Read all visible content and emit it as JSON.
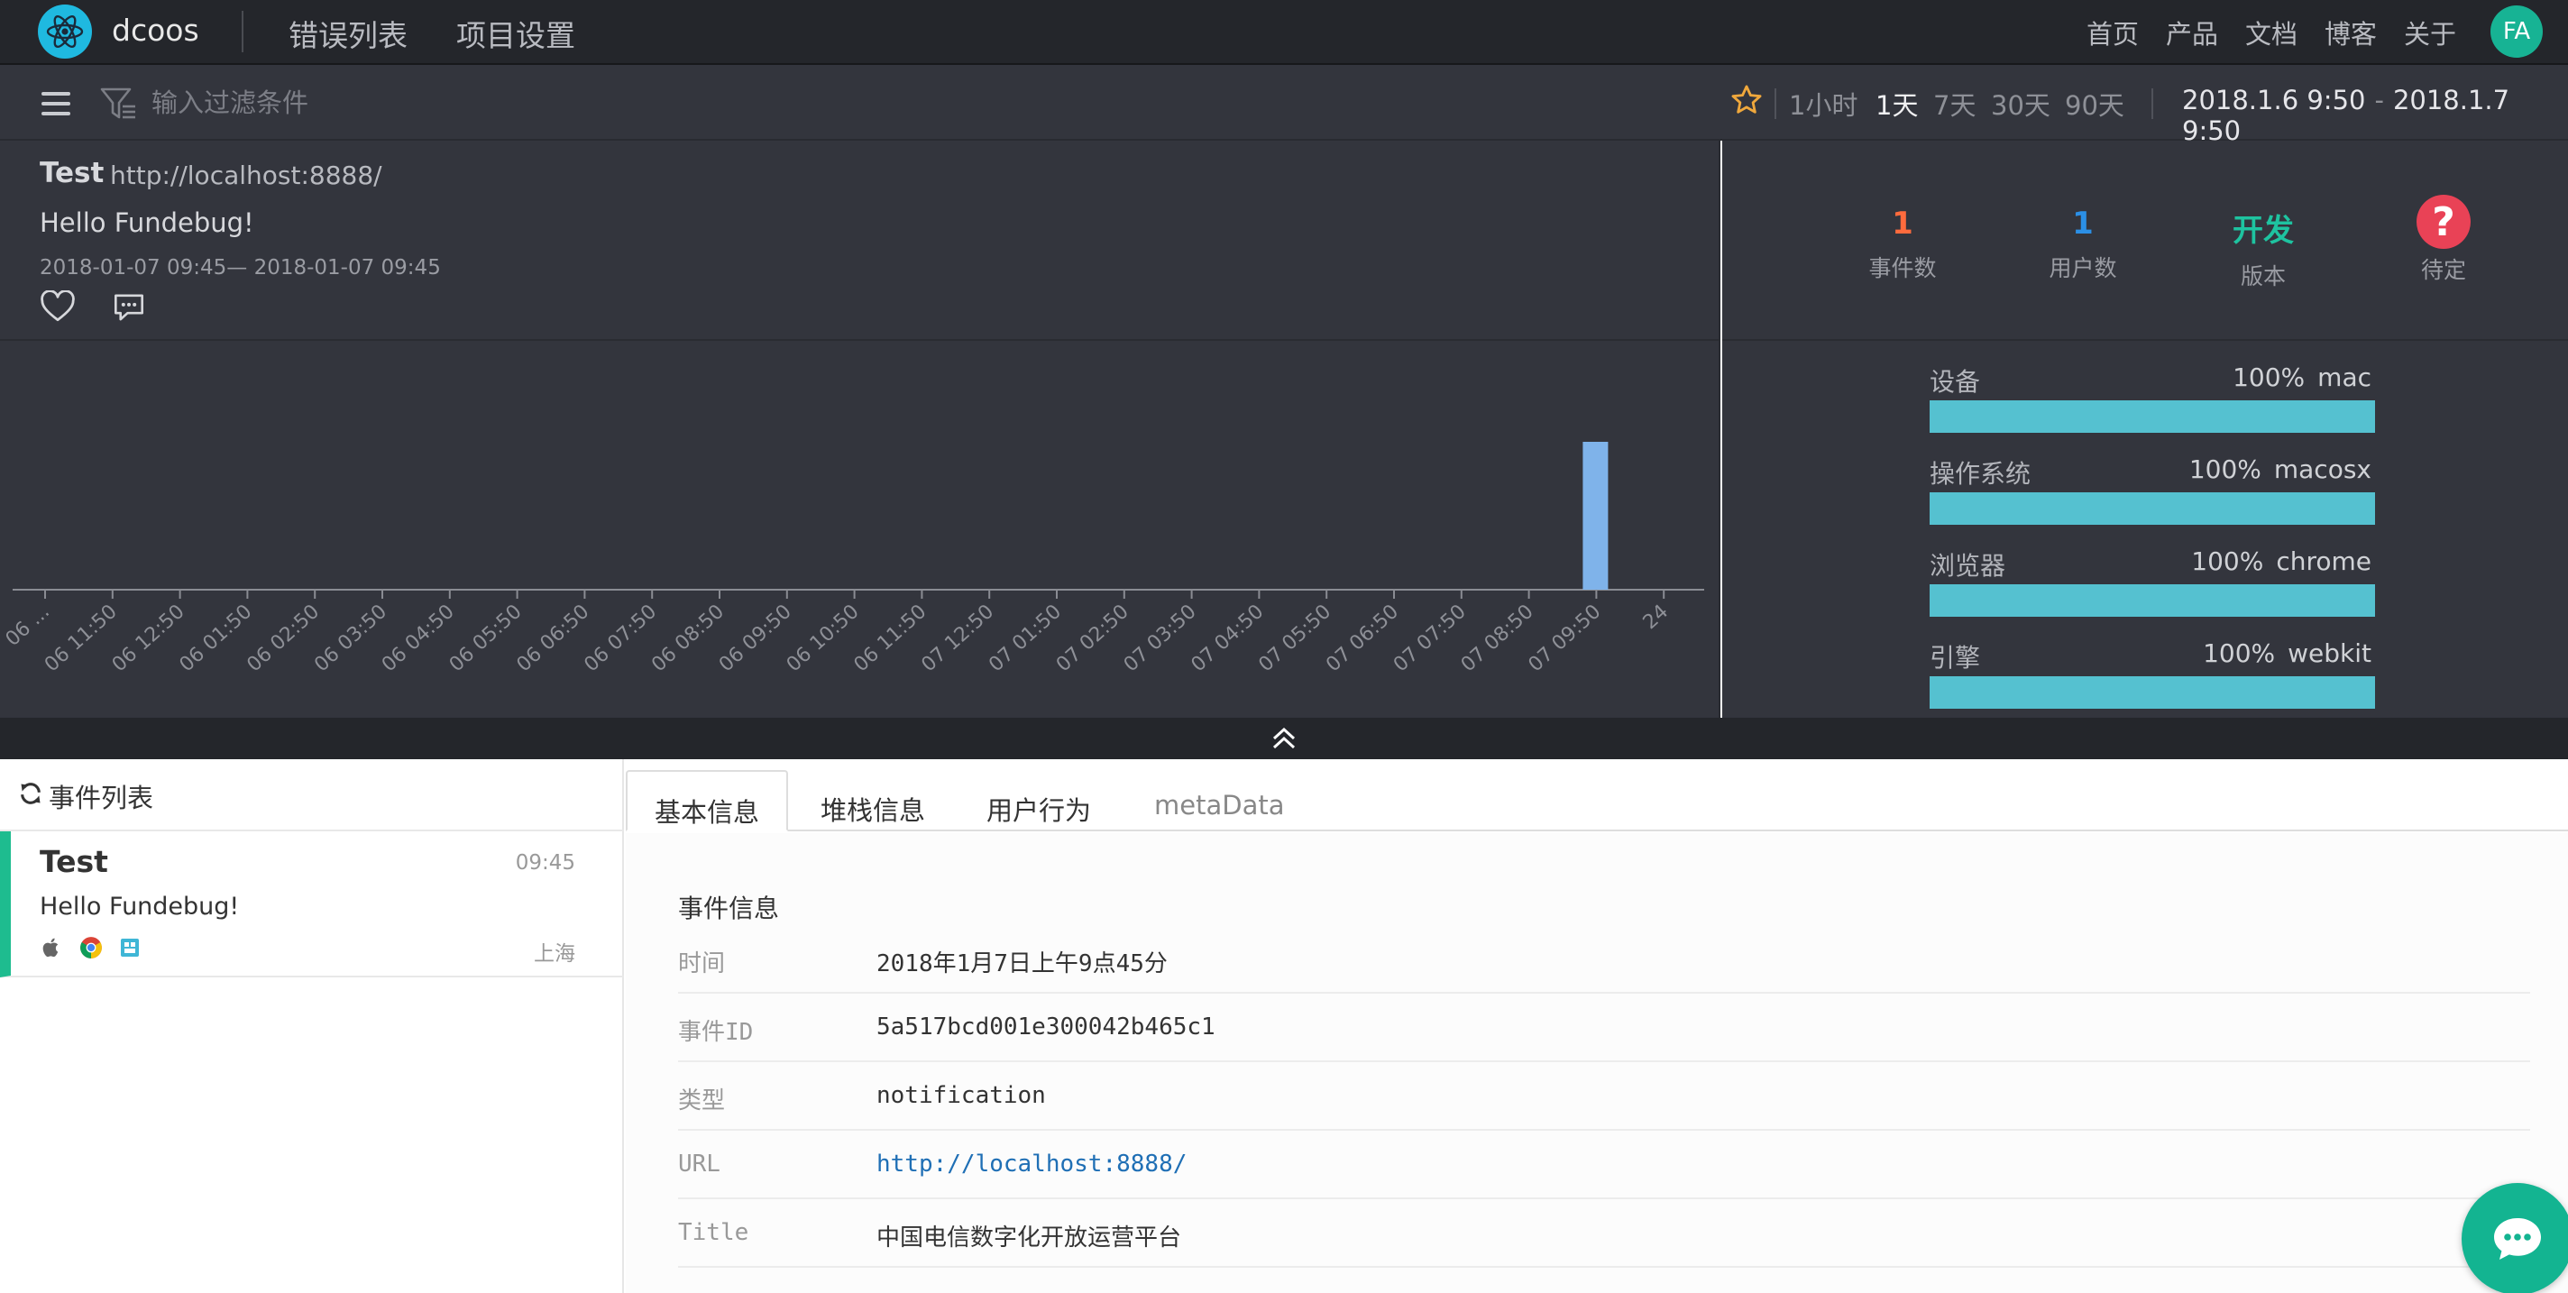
{
  "topnav": {
    "brand": "dcoos",
    "links": [
      "错误列表",
      "项目设置"
    ],
    "right_links": [
      "首页",
      "产品",
      "文档",
      "博客",
      "关于"
    ],
    "avatar": "FA"
  },
  "filterbar": {
    "placeholder": "输入过滤条件",
    "ranges": [
      "1小时",
      "1天",
      "7天",
      "30天",
      "90天"
    ],
    "active_range": "1天",
    "date_from": "2018.1.6 9:50",
    "date_sep": "-",
    "date_to": "2018.1.7 9:50"
  },
  "summary": {
    "title": "Test",
    "url": "http://localhost:8888/",
    "message": "Hello Fundebug!",
    "time_range": "2018-01-07 09:45— 2018-01-07 09:45"
  },
  "stats": [
    {
      "value": "1",
      "label": "事件数",
      "color": "#ff6b3d"
    },
    {
      "value": "1",
      "label": "用户数",
      "color": "#2b8fe6"
    },
    {
      "value": "开发",
      "label": "版本",
      "color": "#1ec3a0"
    },
    {
      "value": "?",
      "label": "待定",
      "color": "#e94256"
    }
  ],
  "chart_data": {
    "type": "bar",
    "categories": [
      "06 ...",
      "06 11:50",
      "06 12:50",
      "06 01:50",
      "06 02:50",
      "06 03:50",
      "06 04:50",
      "06 05:50",
      "06 06:50",
      "06 07:50",
      "06 08:50",
      "06 09:50",
      "06 10:50",
      "06 11:50",
      "07 12:50",
      "07 01:50",
      "07 02:50",
      "07 03:50",
      "07 04:50",
      "07 05:50",
      "07 06:50",
      "07 07:50",
      "07 08:50",
      "07 09:50",
      "24"
    ],
    "values": [
      0,
      0,
      0,
      0,
      0,
      0,
      0,
      0,
      0,
      0,
      0,
      0,
      0,
      0,
      0,
      0,
      0,
      0,
      0,
      0,
      0,
      0,
      0,
      1,
      0
    ],
    "bar_color": "#7fb3ea"
  },
  "distribution": [
    {
      "label": "设备",
      "percent": "100%",
      "value": "mac",
      "fraction": 1.0
    },
    {
      "label": "操作系统",
      "percent": "100%",
      "value": "macosx",
      "fraction": 1.0
    },
    {
      "label": "浏览器",
      "percent": "100%",
      "value": "chrome",
      "fraction": 1.0
    },
    {
      "label": "引擎",
      "percent": "100%",
      "value": "webkit",
      "fraction": 1.0
    }
  ],
  "event_list": {
    "title": "事件列表",
    "items": [
      {
        "name": "Test",
        "time": "09:45",
        "message": "Hello Fundebug!",
        "city": "上海"
      }
    ]
  },
  "tabs": [
    {
      "label": "基本信息",
      "active": true
    },
    {
      "label": "堆栈信息",
      "active": false
    },
    {
      "label": "用户行为",
      "active": false
    },
    {
      "label": "metaData",
      "active": false
    }
  ],
  "event_info": {
    "title": "事件信息",
    "rows": [
      {
        "key": "时间",
        "value": "2018年1月7日上午9点45分"
      },
      {
        "key": "事件ID",
        "value": "5a517bcd001e300042b465c1"
      },
      {
        "key": "类型",
        "value": "notification"
      },
      {
        "key": "URL",
        "value": "http://localhost:8888/"
      },
      {
        "key": "Title",
        "value": "中国电信数字化开放运营平台"
      }
    ]
  }
}
